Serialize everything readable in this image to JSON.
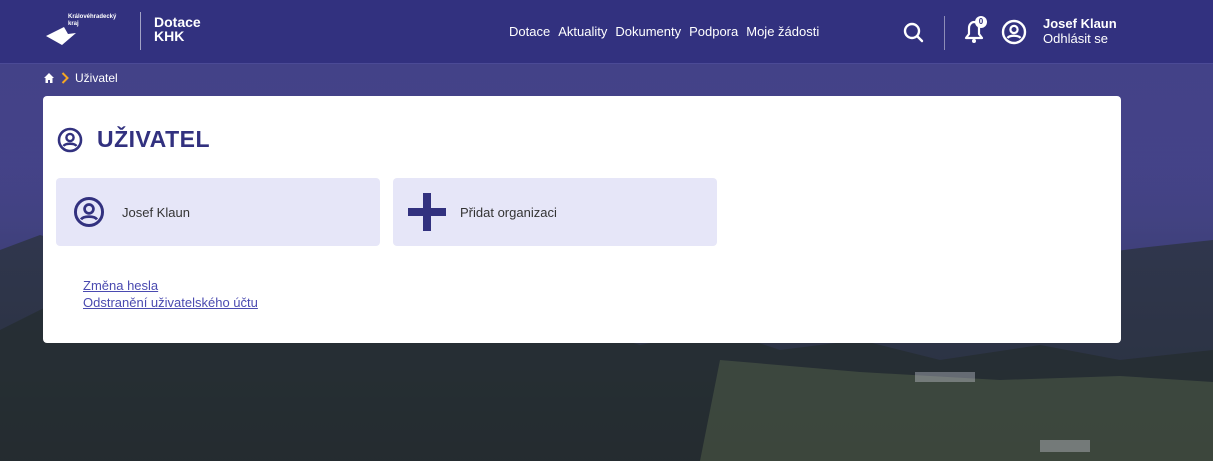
{
  "header": {
    "logo_text_line1": "Královéhradecký",
    "logo_text_line2": "kraj",
    "brand_line1": "Dotace",
    "brand_line2": "KHK",
    "nav": [
      "Dotace",
      "Aktuality",
      "Dokumenty",
      "Podpora",
      "Moje žádosti"
    ],
    "notification_count": "0",
    "user_name": "Josef Klaun",
    "logout_label": "Odhlásit se"
  },
  "breadcrumb": {
    "current": "Uživatel"
  },
  "main": {
    "title": "UŽIVATEL",
    "tiles": {
      "user_label": "Josef Klaun",
      "add_org_label": "Přidat organizaci"
    },
    "links": {
      "change_password": "Změna hesla",
      "delete_account": "Odstranění uživatelského účtu"
    }
  },
  "colors": {
    "primary": "#32317f",
    "tile_bg": "#e6e6f8",
    "breadcrumb_chevron": "#f5a623",
    "link": "#4a4ab0"
  },
  "icons": {
    "logo": "kraj-logo-icon",
    "search": "search-icon",
    "bell": "bell-icon",
    "user": "user-circle-icon",
    "home": "home-icon",
    "chevron": "chevron-right-icon",
    "plus": "plus-icon"
  }
}
